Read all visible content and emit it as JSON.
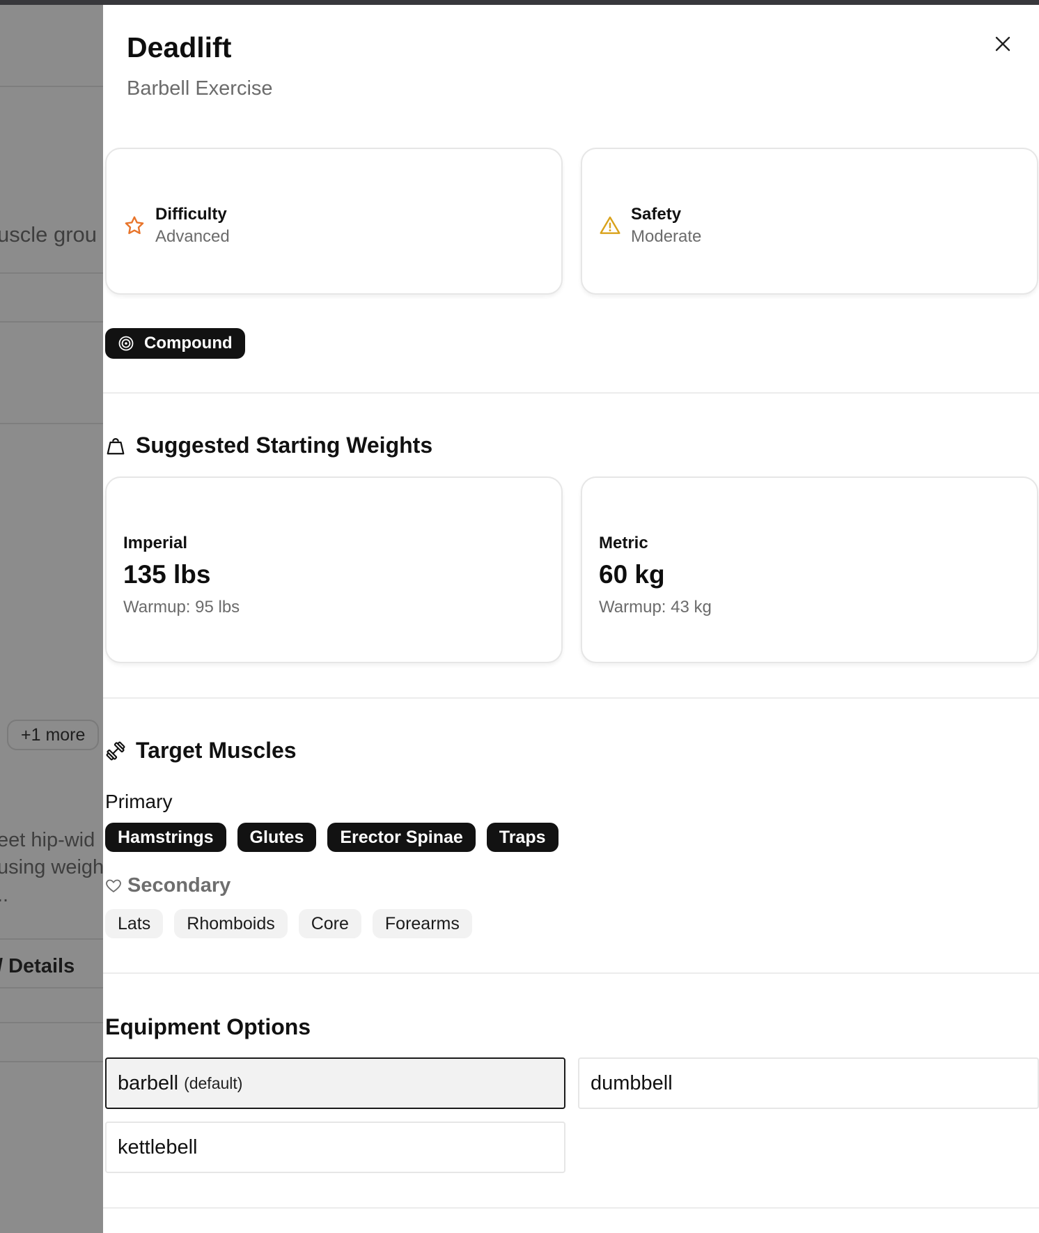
{
  "background": {
    "partial_text_1": "uscle grou",
    "more_badge": "+1 more",
    "partial_text_2": "eet hip-wid",
    "partial_text_3": "using weigh",
    "partial_text_4": "..",
    "details_link": "/ Details"
  },
  "panel": {
    "title": "Deadlift",
    "subtitle": "Barbell Exercise",
    "difficulty": {
      "label": "Difficulty",
      "value": "Advanced"
    },
    "safety": {
      "label": "Safety",
      "value": "Moderate"
    },
    "compound_badge": "Compound",
    "weights": {
      "heading": "Suggested Starting Weights",
      "imperial": {
        "label": "Imperial",
        "value": "135 lbs",
        "warmup": "Warmup: 95 lbs"
      },
      "metric": {
        "label": "Metric",
        "value": "60 kg",
        "warmup": "Warmup: 43 kg"
      }
    },
    "muscles": {
      "heading": "Target Muscles",
      "primary_label": "Primary",
      "primary": [
        "Hamstrings",
        "Glutes",
        "Erector Spinae",
        "Traps"
      ],
      "secondary_label": "Secondary",
      "secondary": [
        "Lats",
        "Rhomboids",
        "Core",
        "Forearms"
      ]
    },
    "equipment": {
      "heading": "Equipment Options",
      "options": [
        {
          "name": "barbell",
          "note": "(default)"
        },
        {
          "name": "dumbbell",
          "note": ""
        },
        {
          "name": "kettlebell",
          "note": ""
        }
      ]
    }
  },
  "colors": {
    "difficulty_icon": "#e8742a",
    "safety_icon": "#d9a21b",
    "dark_tag": "#121212",
    "light_tag": "#f2f2f2"
  }
}
